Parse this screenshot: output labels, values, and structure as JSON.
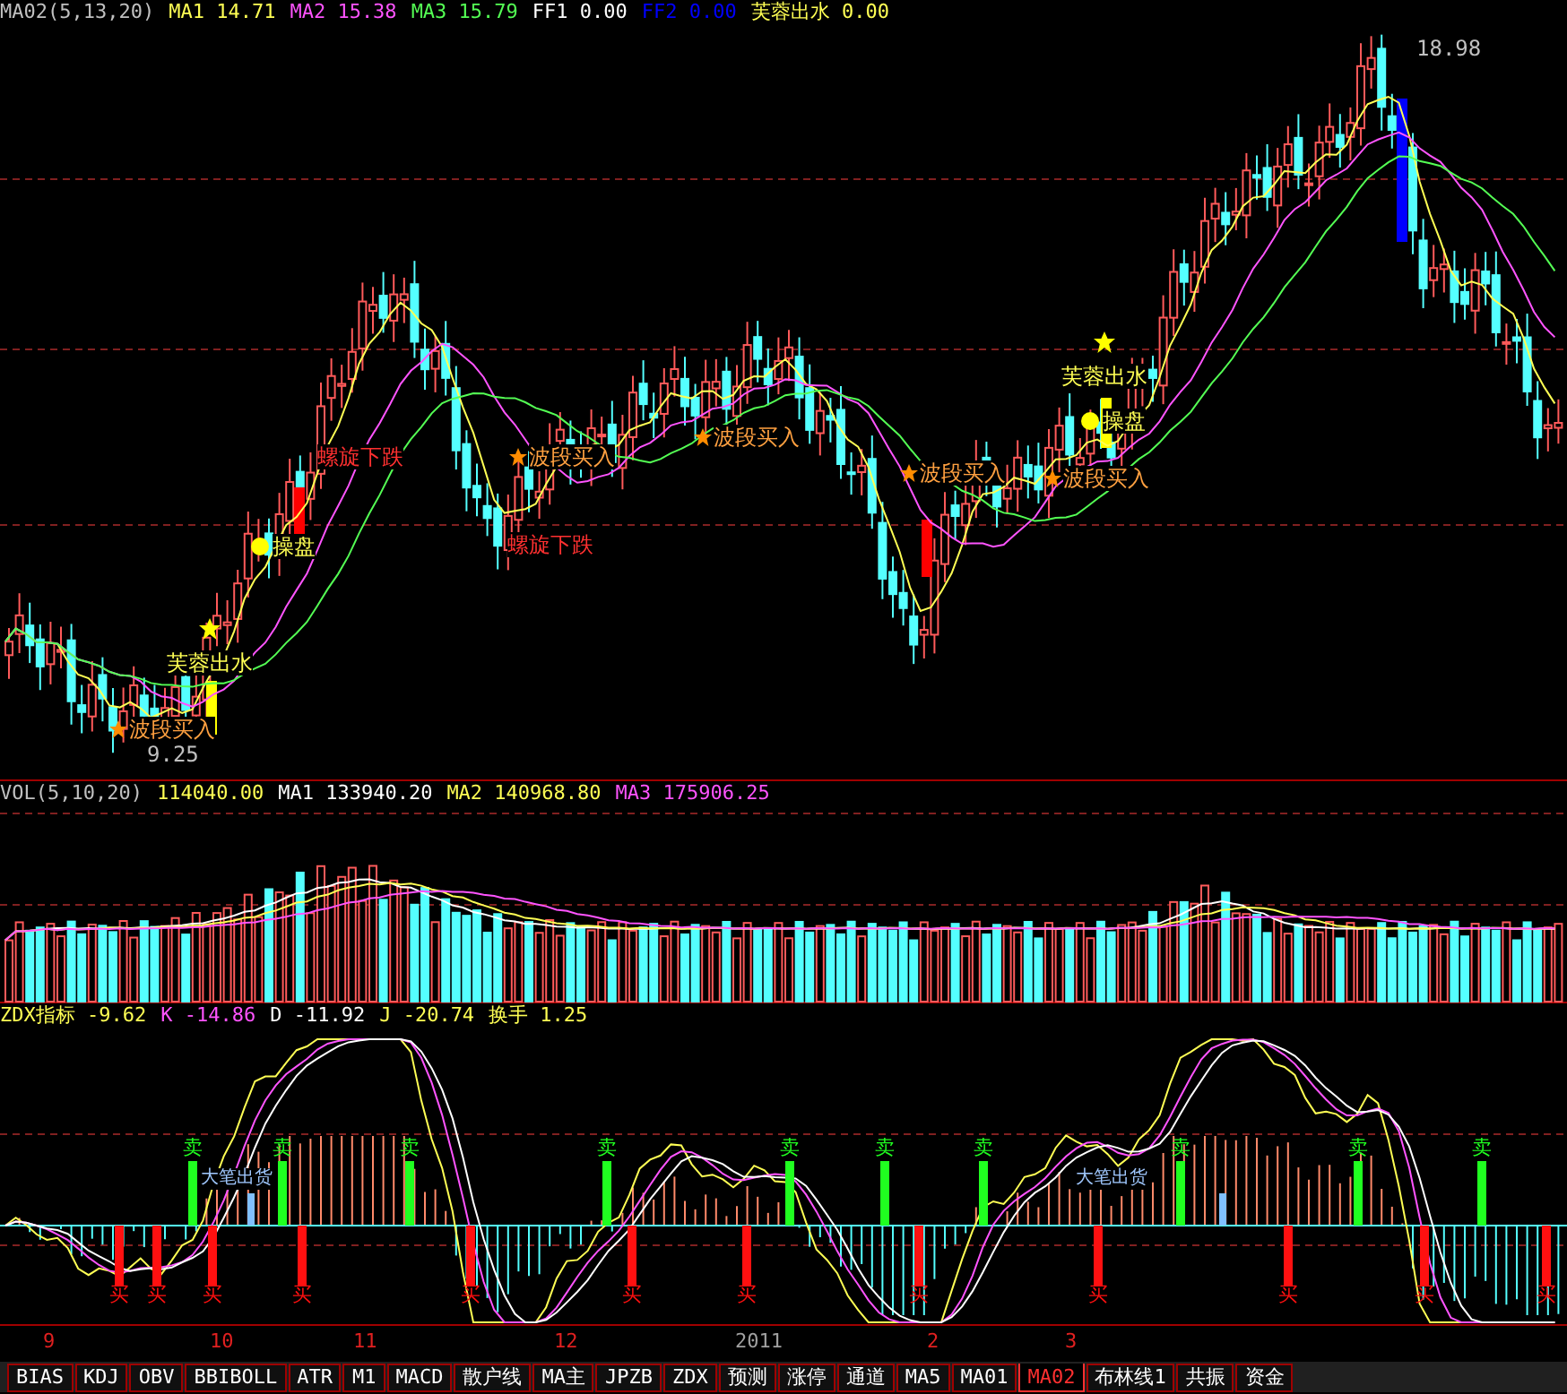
{
  "main_panel": {
    "header": [
      {
        "text": "MA02(5,13,20)",
        "color": "#c0c0c0"
      },
      {
        "text": "MA1 14.71",
        "color": "#ffff54"
      },
      {
        "text": "MA2 15.38",
        "color": "#ff54ff"
      },
      {
        "text": "MA3 15.79",
        "color": "#54ff54"
      },
      {
        "text": "FF1 0.00",
        "color": "#ffffff"
      },
      {
        "text": "FF2 0.00",
        "color": "#0000ff"
      },
      {
        "text": "芙蓉出水 0.00",
        "color": "#ffff54"
      }
    ],
    "annotations": [
      {
        "kind": "rise",
        "text": "芙蓉出水"
      },
      {
        "kind": "wave_buy",
        "text": "波段买入"
      },
      {
        "kind": "operate",
        "text": "操盘"
      },
      {
        "kind": "fall",
        "text": "螺旋下跌"
      },
      {
        "kind": "wave_buy",
        "text": "波段买入"
      },
      {
        "kind": "fall",
        "text": "螺旋下跌"
      },
      {
        "kind": "wave_buy",
        "text": "波段买入"
      },
      {
        "kind": "wave_buy",
        "text": "波段买入"
      },
      {
        "kind": "rise",
        "text": "芙蓉出水"
      },
      {
        "kind": "operate",
        "text": "操盘"
      },
      {
        "kind": "wave_buy",
        "text": "波段买入"
      },
      {
        "kind": "price",
        "text": "9.25"
      },
      {
        "kind": "price",
        "text": "18.98"
      }
    ]
  },
  "volume_panel": {
    "header": [
      {
        "text": "VOL(5,10,20)",
        "color": "#c0c0c0"
      },
      {
        "text": "114040.00",
        "color": "#ffff54"
      },
      {
        "text": "MA1 133940.20",
        "color": "#ffffff"
      },
      {
        "text": "MA2 140968.80",
        "color": "#ffff54"
      },
      {
        "text": "MA3 175906.25",
        "color": "#ff54ff"
      }
    ]
  },
  "zdx_panel": {
    "header": [
      {
        "text": "ZDX指标 -9.62",
        "color": "#ffff54"
      },
      {
        "text": "K -14.86",
        "color": "#ff54ff"
      },
      {
        "text": "D -11.92",
        "color": "#ffffff"
      },
      {
        "text": "J -20.74",
        "color": "#ffff54"
      },
      {
        "text": "换手 1.25",
        "color": "#ffff54"
      }
    ],
    "signals": [
      {
        "kind": "sell",
        "label": "卖"
      },
      {
        "kind": "sell",
        "label": "卖"
      },
      {
        "kind": "sell",
        "label": "卖"
      },
      {
        "kind": "sell",
        "label": "卖"
      },
      {
        "kind": "sell",
        "label": "卖"
      },
      {
        "kind": "sell",
        "label": "卖"
      },
      {
        "kind": "sell",
        "label": "卖"
      },
      {
        "kind": "sell",
        "label": "卖"
      },
      {
        "kind": "sell",
        "label": "卖"
      },
      {
        "kind": "sell",
        "label": "卖"
      },
      {
        "kind": "buy",
        "label": "买"
      },
      {
        "kind": "buy",
        "label": "买"
      },
      {
        "kind": "buy",
        "label": "买"
      },
      {
        "kind": "buy",
        "label": "买"
      },
      {
        "kind": "buy",
        "label": "买"
      },
      {
        "kind": "buy",
        "label": "买"
      },
      {
        "kind": "buy",
        "label": "买"
      },
      {
        "kind": "buy",
        "label": "买"
      },
      {
        "kind": "buy",
        "label": "买"
      },
      {
        "kind": "buy",
        "label": "买"
      },
      {
        "kind": "buy",
        "label": "买"
      },
      {
        "kind": "buy",
        "label": "买"
      }
    ],
    "notes": [
      {
        "text": "大笔出货"
      },
      {
        "text": "大笔出货"
      }
    ]
  },
  "time_axis": [
    {
      "kind": "month",
      "text": "9"
    },
    {
      "kind": "month",
      "text": "10"
    },
    {
      "kind": "month",
      "text": "11"
    },
    {
      "kind": "month",
      "text": "12"
    },
    {
      "kind": "year",
      "text": "2011"
    },
    {
      "kind": "month",
      "text": "2"
    },
    {
      "kind": "month",
      "text": "3"
    }
  ],
  "tabs": [
    {
      "label": "BIAS",
      "selected": false
    },
    {
      "label": "KDJ",
      "selected": false
    },
    {
      "label": "OBV",
      "selected": false
    },
    {
      "label": "BBIBOLL",
      "selected": false
    },
    {
      "label": "ATR",
      "selected": false
    },
    {
      "label": "M1",
      "selected": false
    },
    {
      "label": "MACD",
      "selected": false
    },
    {
      "label": "散户线",
      "selected": false
    },
    {
      "label": "MA主",
      "selected": false
    },
    {
      "label": "JPZB",
      "selected": false
    },
    {
      "label": "ZDX",
      "selected": false
    },
    {
      "label": "预测",
      "selected": false
    },
    {
      "label": "涨停",
      "selected": false
    },
    {
      "label": "通道",
      "selected": false
    },
    {
      "label": "MA5",
      "selected": false
    },
    {
      "label": "MA01",
      "selected": false
    },
    {
      "label": "MA02",
      "selected": true
    },
    {
      "label": "布林线1",
      "selected": false
    },
    {
      "label": "共振",
      "selected": false
    },
    {
      "label": "资金",
      "selected": false
    }
  ]
}
